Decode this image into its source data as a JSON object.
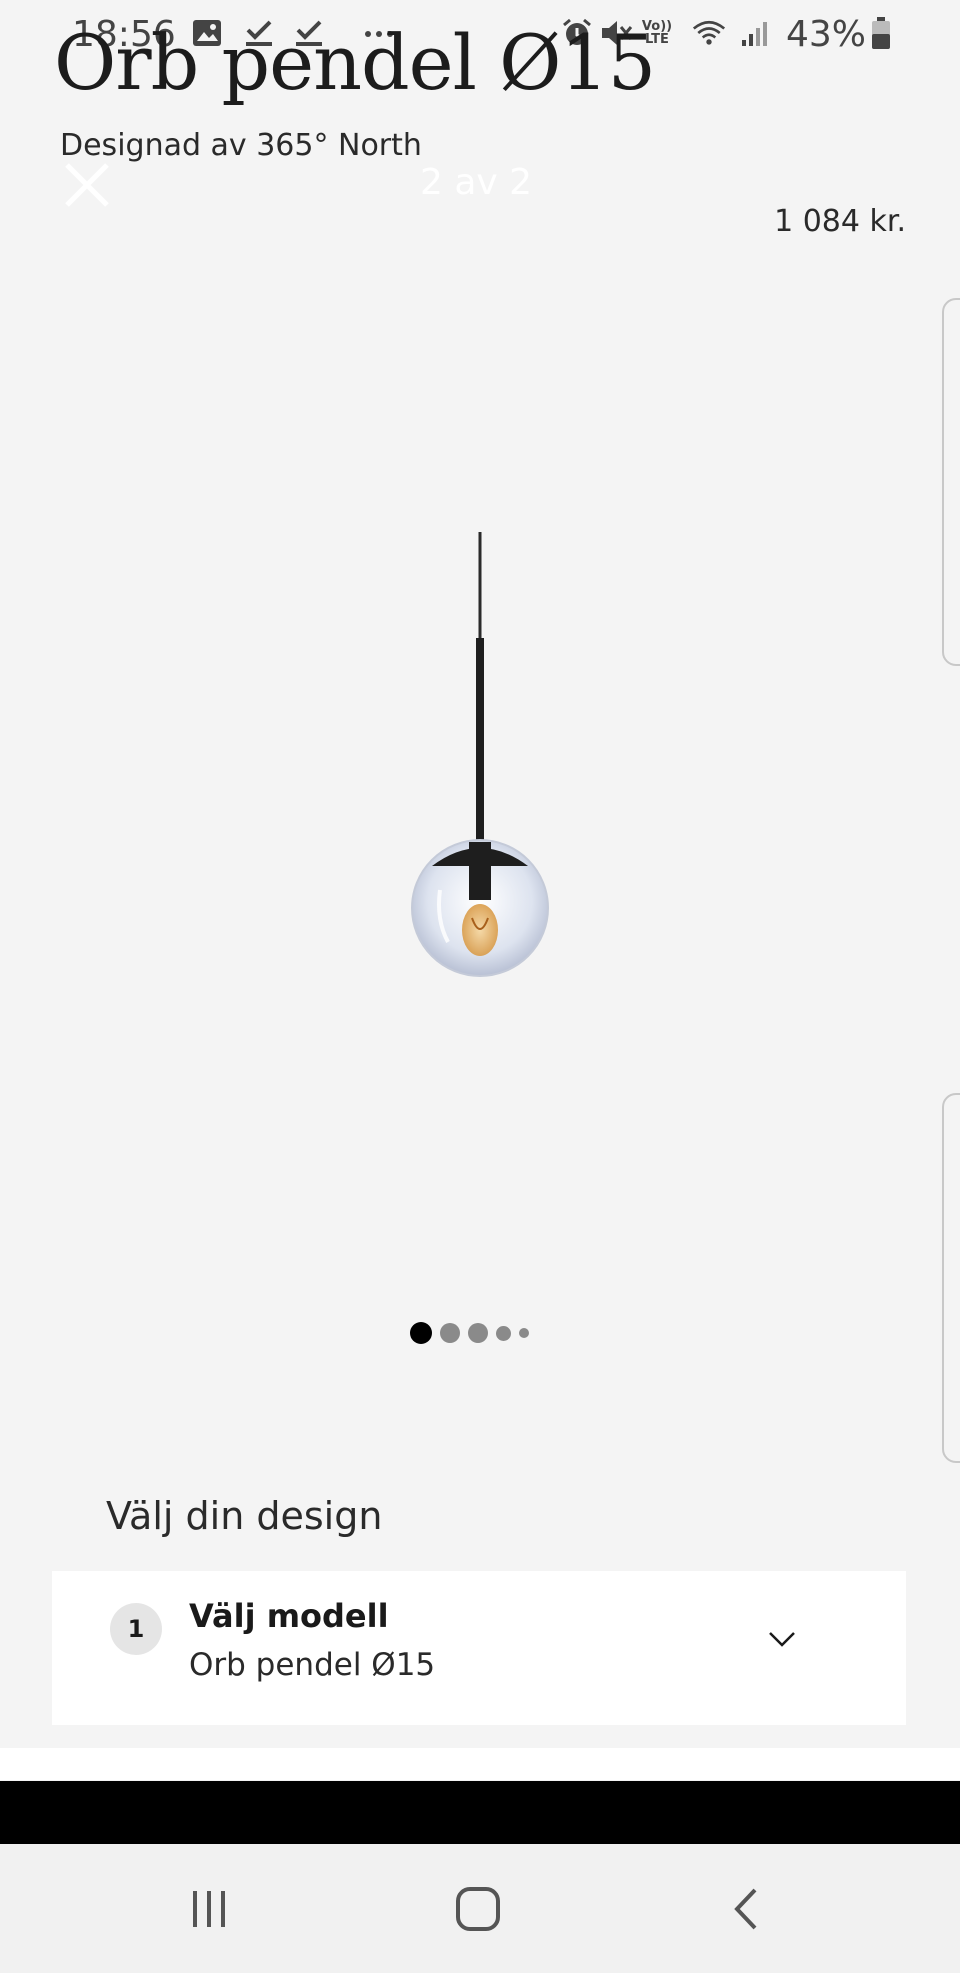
{
  "status_bar": {
    "time": "18:56",
    "battery": "43%",
    "icons": [
      "image-icon",
      "check-icon",
      "check-icon",
      "more-dots-icon",
      "alarm-icon",
      "mute-icon",
      "volte-icon",
      "wifi-icon",
      "signal-icon",
      "battery-icon"
    ]
  },
  "product": {
    "title": "Orb pendel Ø15",
    "designer": "Designad av 365° North",
    "price": "1 084 kr."
  },
  "viewer": {
    "counter": "2 av 2",
    "dots_total": 5,
    "active_dot": 0
  },
  "design_selector": {
    "heading": "Välj din design",
    "step_number": "1",
    "step_label": "Välj modell",
    "selected_value": "Orb pendel Ø15"
  },
  "colors": {
    "background": "#f4f4f4",
    "card": "#ffffff",
    "text": "#1a1a1a",
    "dot_active": "#000000",
    "dot_inactive": "#8a8a8a"
  }
}
